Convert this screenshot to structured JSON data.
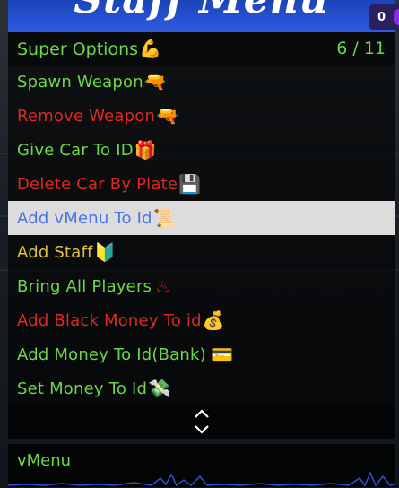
{
  "banner": {
    "title": "Staff Menu"
  },
  "subheader": {
    "title": "Super Options",
    "title_icon": "flexed-biceps-icon",
    "counter": "6 / 11"
  },
  "items": [
    {
      "label": "Spawn Weapon",
      "icon": "water-pistol-icon",
      "color": "#6dd649"
    },
    {
      "label": "Remove Weapon",
      "icon": "water-pistol-icon",
      "color": "#e0291f"
    },
    {
      "label": "Give Car To ID",
      "icon": "gift-icon",
      "color": "#6dd649"
    },
    {
      "label": "Delete Car By Plate",
      "icon": "floppy-disk-icon",
      "color": "#e0291f"
    },
    {
      "label": "Add vMenu To Id",
      "icon": "scroll-icon",
      "color": "#4a74e6",
      "selected": true
    },
    {
      "label": "Add Staff",
      "icon": "beginner-shield-icon",
      "color": "#e3c03a"
    },
    {
      "label": "Bring All Players",
      "icon": "hot-springs-icon",
      "color": "#6dd649"
    },
    {
      "label": "Add Black Money To id",
      "icon": "money-bag-icon",
      "color": "#e0291f"
    },
    {
      "label": "Add Money To Id(Bank)",
      "icon": "credit-card-icon",
      "color": "#6dd649"
    },
    {
      "label": "Set Money To Id",
      "icon": "money-with-wings-icon",
      "color": "#6dd649"
    }
  ],
  "description": {
    "text": "vMenu"
  },
  "hud_badge": {
    "value": "0"
  }
}
